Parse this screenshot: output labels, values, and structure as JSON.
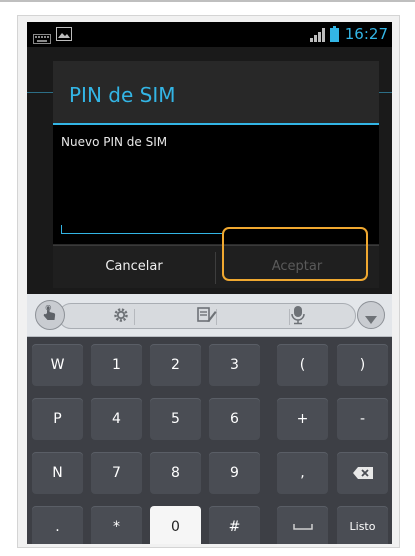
{
  "status_bar": {
    "time": "16:27",
    "icons": [
      "keyboard-notification-icon",
      "image-notification-icon",
      "signal-icon",
      "battery-icon"
    ],
    "accent_color": "#33b5e5"
  },
  "dialog": {
    "title": "PIN de SIM",
    "field_label": "Nuevo PIN de SIM",
    "field_value": "",
    "cancel_label": "Cancelar",
    "accept_label": "Aceptar",
    "accept_enabled": false
  },
  "annotation": {
    "highlight_color": "#f0a830",
    "target": "accept-button"
  },
  "keyboard": {
    "toolbar_icons": [
      "hand-icon",
      "gear-icon",
      "edit-icon",
      "mic-icon",
      "chevron-down-icon"
    ],
    "rows": [
      [
        "W",
        "1",
        "2",
        "3",
        "(",
        ")"
      ],
      [
        "P",
        "4",
        "5",
        "6",
        "+",
        "-"
      ],
      [
        "N",
        "7",
        "8",
        "9",
        ",",
        "backspace"
      ],
      [
        ".",
        "*",
        "0",
        "#",
        "space",
        "Listo"
      ]
    ]
  }
}
